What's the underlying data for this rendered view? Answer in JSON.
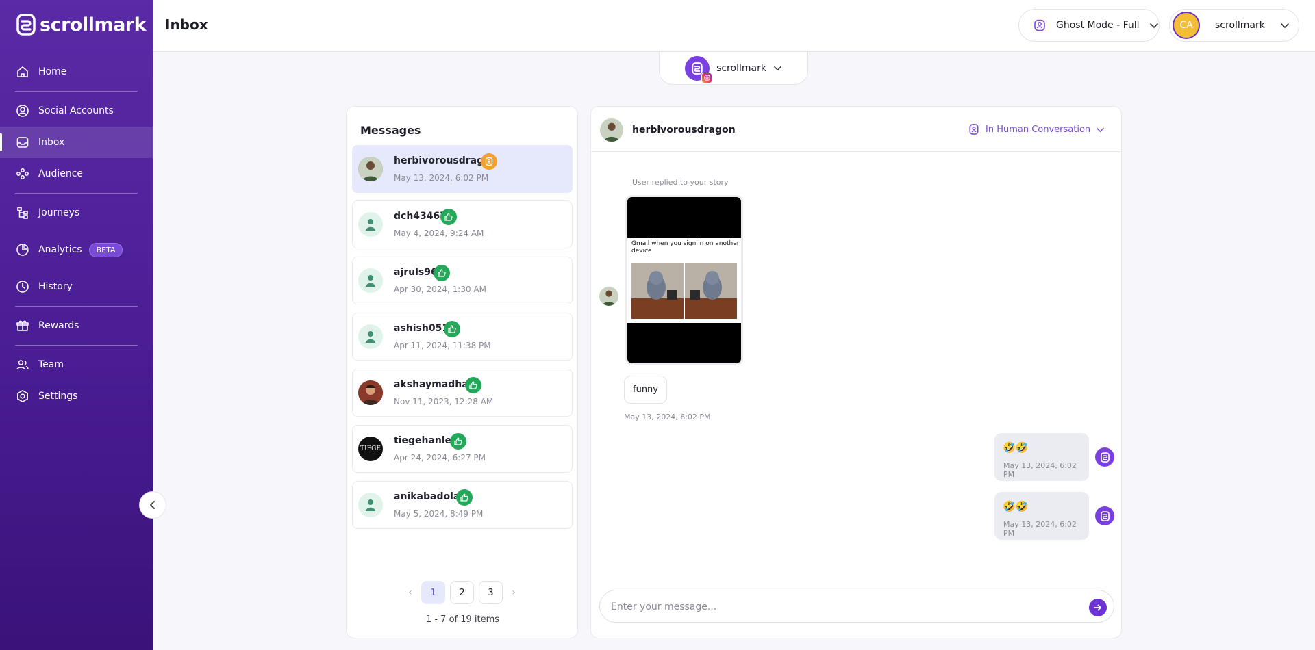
{
  "app": {
    "brand": "scrollmark"
  },
  "sidebar": {
    "items": [
      {
        "label": "Home",
        "icon": "home-icon"
      },
      {
        "label": "Social Accounts",
        "icon": "user-circle-icon"
      },
      {
        "label": "Inbox",
        "icon": "inbox-icon",
        "active": true
      },
      {
        "label": "Audience",
        "icon": "audience-icon"
      },
      {
        "label": "Journeys",
        "icon": "journeys-icon"
      },
      {
        "label": "Analytics",
        "icon": "pie-chart-icon",
        "badge": "BETA"
      },
      {
        "label": "History",
        "icon": "history-icon"
      },
      {
        "label": "Rewards",
        "icon": "gift-icon"
      },
      {
        "label": "Team",
        "icon": "team-icon"
      },
      {
        "label": "Settings",
        "icon": "settings-icon"
      }
    ]
  },
  "header": {
    "title": "Inbox",
    "ghost_mode": "Ghost Mode - Full",
    "account_initials": "CA",
    "account_name": "scrollmark"
  },
  "account_tab": {
    "name": "scrollmark"
  },
  "messages": {
    "title": "Messages",
    "conversations": [
      {
        "username": "herbivorousdragon",
        "date": "May 13, 2024, 6:02 PM",
        "status": "human"
      },
      {
        "username": "dch43467",
        "date": "May 4, 2024, 9:24 AM",
        "status": "liked"
      },
      {
        "username": "ajruls96",
        "date": "Apr 30, 2024, 1:30 AM",
        "status": "liked"
      },
      {
        "username": "ashish0515",
        "date": "Apr 11, 2024, 11:38 PM",
        "status": "liked"
      },
      {
        "username": "akshaymadhani",
        "date": "Nov 11, 2023, 12:28 AM",
        "status": "liked"
      },
      {
        "username": "tiegehanley",
        "date": "Apr 24, 2024, 6:27 PM",
        "status": "liked",
        "avatar_text": "TIEGE"
      },
      {
        "username": "anikabadola_",
        "date": "May 5, 2024, 8:49 PM",
        "status": "liked"
      }
    ],
    "pagination": {
      "pages": [
        "1",
        "2",
        "3"
      ],
      "current": "1",
      "summary": "1 - 7 of 19 items"
    }
  },
  "chat": {
    "username": "herbivorousdragon",
    "status": "In Human Conversation",
    "story_label": "User replied to your story",
    "story_caption": "Gmail when you sign in on another device",
    "incoming": {
      "text": "funny",
      "time": "May 13, 2024, 6:02 PM"
    },
    "outgoing": [
      {
        "text": "🤣🤣",
        "time": "May 13, 2024, 6:02 PM"
      },
      {
        "text": "🤣🤣",
        "time": "May 13, 2024, 6:02 PM"
      }
    ],
    "input_placeholder": "Enter your message..."
  },
  "colors": {
    "brand_purple": "#5b2aa6",
    "accent": "#6b33d6",
    "liked_green": "#24a85a",
    "human_orange": "#f0a132"
  }
}
